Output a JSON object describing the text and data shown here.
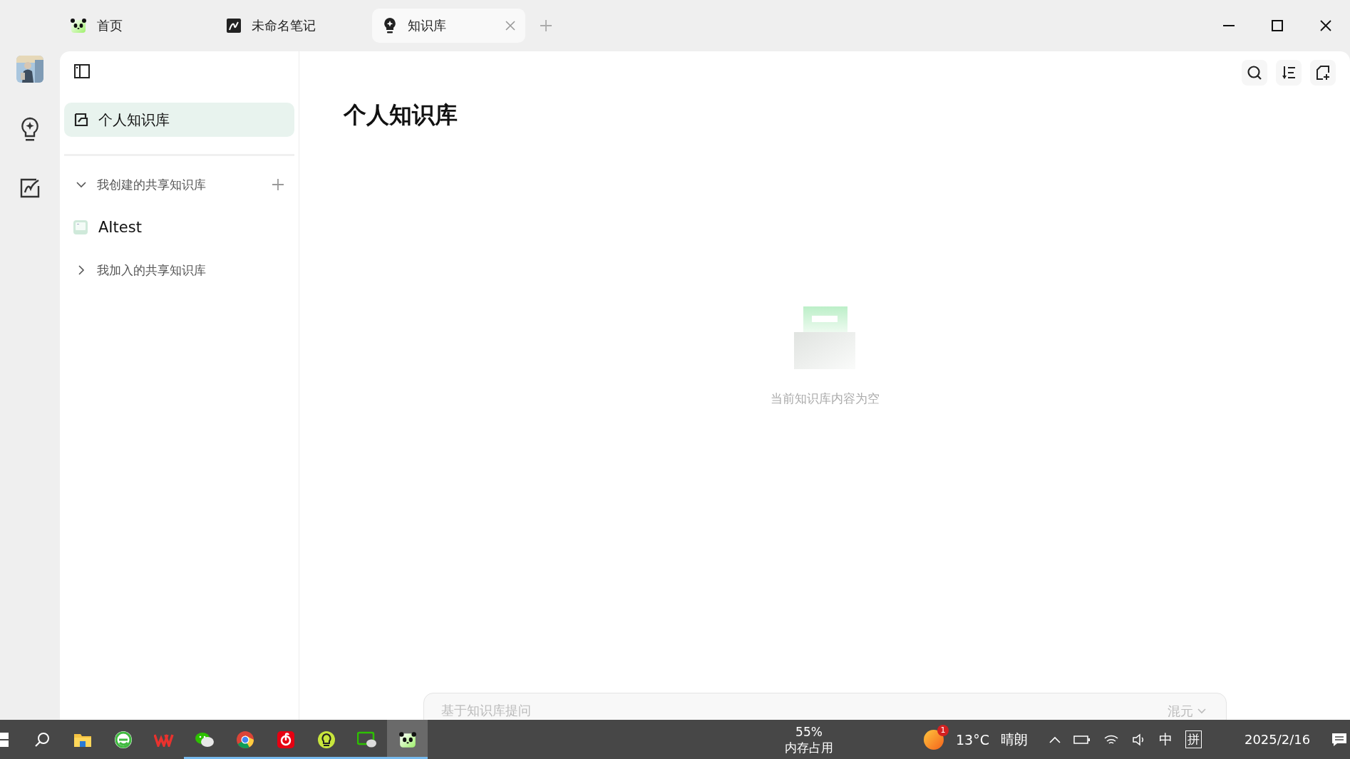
{
  "tabs": [
    {
      "label": "首页",
      "kind": "panda",
      "selected": false
    },
    {
      "label": "未命名笔记",
      "kind": "note",
      "selected": false
    },
    {
      "label": "知识库",
      "kind": "bulb",
      "selected": true
    }
  ],
  "sidebar": {
    "title": "个人知识库",
    "title_selected": true,
    "groups": [
      {
        "label": "我创建的共享知识库",
        "expanded": true,
        "children": [
          {
            "label": "AItest"
          }
        ]
      },
      {
        "label": "我加入的共享知识库",
        "expanded": false
      }
    ]
  },
  "content": {
    "title": "个人知识库",
    "empty_message": "当前知识库内容为空",
    "ask": {
      "placeholder": "基于知识库提问",
      "model": "混元"
    }
  },
  "taskbar": {
    "apps": [
      {
        "kind": "explorer",
        "running": false,
        "selected": false
      },
      {
        "kind": "browser",
        "running": false,
        "selected": false
      },
      {
        "kind": "wps",
        "running": false,
        "selected": false
      },
      {
        "kind": "wechat",
        "running": true,
        "selected": false
      },
      {
        "kind": "chrome",
        "running": true,
        "selected": false
      },
      {
        "kind": "music",
        "running": true,
        "selected": false
      },
      {
        "kind": "bulb",
        "running": true,
        "selected": false
      },
      {
        "kind": "chat",
        "running": true,
        "selected": false
      },
      {
        "kind": "panda",
        "running": true,
        "selected": true
      }
    ],
    "memory": {
      "percent": "55%",
      "label": "内存占用"
    },
    "weather": {
      "badge": "1",
      "temperature": "13°C",
      "condition": "晴朗"
    },
    "ime": {
      "language": "中",
      "mode": "拼"
    },
    "date": "2025/2/16"
  }
}
